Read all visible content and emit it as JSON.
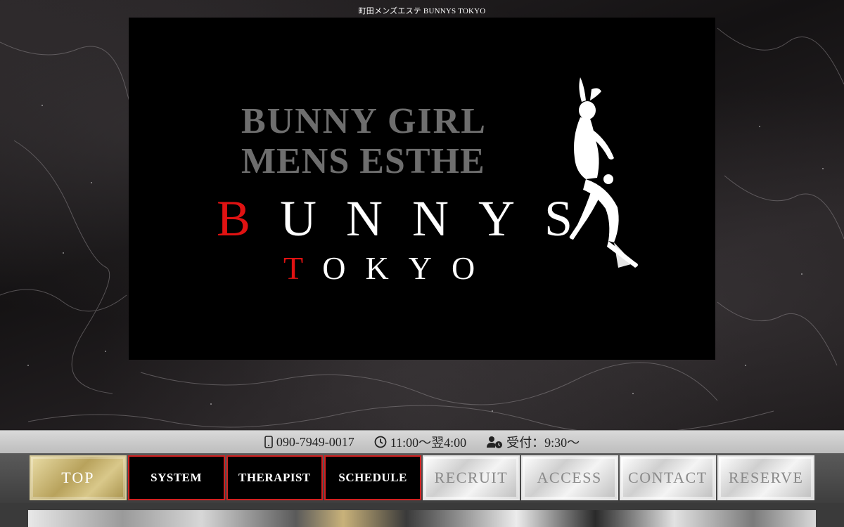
{
  "site_title": "町田メンズエステ BUNNYS TOKYO",
  "logo": {
    "line1": "BUNNY GIRL",
    "line2": "MENS ESTHE",
    "line3_cap": "B",
    "line3_rest": "UNNYS",
    "line4_cap": "T",
    "line4_rest": "OKYO"
  },
  "info": {
    "phone": "090-7949-0017",
    "hours": "11:00～翌4:00",
    "reception": "受付：9:30～"
  },
  "nav": [
    {
      "label": "TOP",
      "style": "gold"
    },
    {
      "label": "SYSTEM",
      "style": "black"
    },
    {
      "label": "THERAPIST",
      "style": "black"
    },
    {
      "label": "SCHEDULE",
      "style": "black"
    },
    {
      "label": "RECRUIT",
      "style": "silver"
    },
    {
      "label": "ACCESS",
      "style": "silver"
    },
    {
      "label": "CONTACT",
      "style": "silver"
    },
    {
      "label": "RESERVE",
      "style": "silver"
    }
  ],
  "colors": {
    "accent_red": "#e01212",
    "gold": "#b8a25c",
    "nav_border_red": "#d12020"
  },
  "icons": [
    "smartphone-icon",
    "clock-icon",
    "user-clock-icon",
    "bunny-girl-silhouette"
  ]
}
